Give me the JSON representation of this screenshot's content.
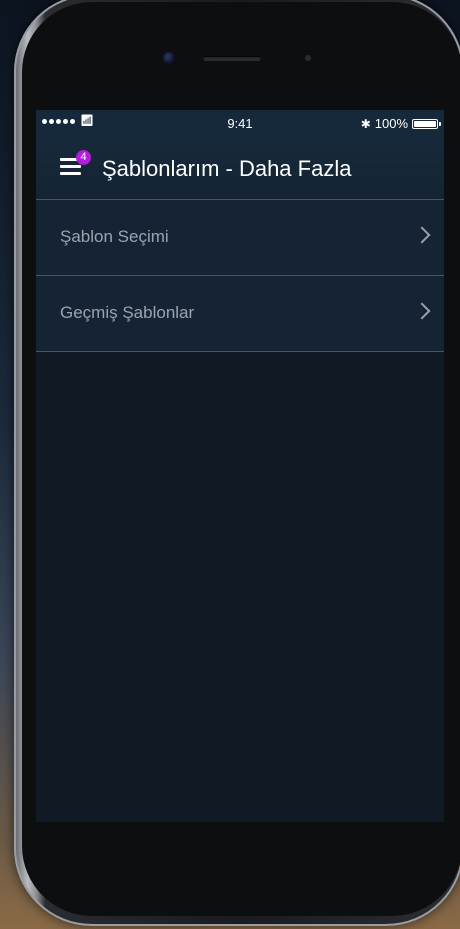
{
  "status_bar": {
    "time": "9:41",
    "battery_percent": "100%",
    "bluetooth_icon": "bluetooth-icon",
    "wifi_icon": "wifi-icon",
    "signal_icon": "signal-dots-icon"
  },
  "nav_bar": {
    "title": "Şablonlarım - Daha Fazla",
    "menu_badge": "4",
    "menu_icon": "hamburger-menu-icon"
  },
  "menu_items": [
    {
      "label": "Şablon Seçimi",
      "icon": "chevron-right-icon"
    },
    {
      "label": "Geçmiş Şablonlar",
      "icon": "chevron-right-icon"
    }
  ],
  "colors": {
    "nav_background": "#16293a",
    "content_background": "#101a25",
    "badge": "#b11ed8",
    "item_text": "#9aa4ae",
    "title_text": "#ffffff"
  }
}
